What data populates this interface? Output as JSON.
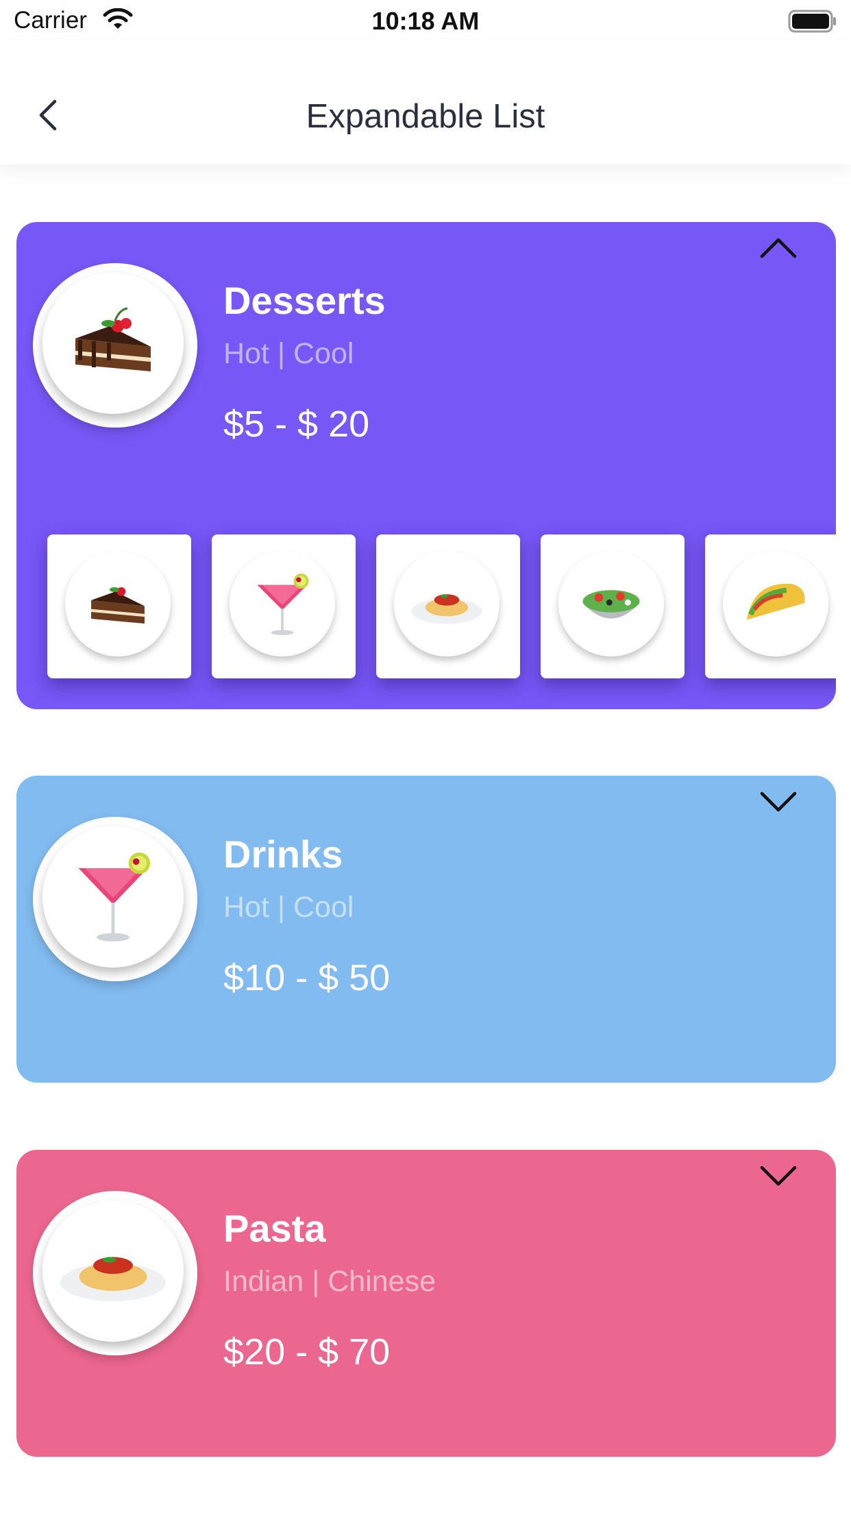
{
  "status_bar": {
    "carrier": "Carrier",
    "time": "10:18 AM"
  },
  "nav": {
    "title": "Expandable List",
    "back_icon": "chevron-left-icon"
  },
  "cards": [
    {
      "title": "Desserts",
      "subtitle": "Hot | Cool",
      "price": "$5 - $ 20",
      "color": "#7757f5",
      "expanded": true,
      "image": "cake-icon",
      "thumbnails": [
        "cake-icon",
        "cocktail-icon",
        "pasta-icon",
        "salad-icon",
        "taco-icon"
      ]
    },
    {
      "title": "Drinks",
      "subtitle": "Hot | Cool",
      "price": "$10 - $ 50",
      "color": "#82bbf0",
      "expanded": false,
      "image": "cocktail-icon"
    },
    {
      "title": "Pasta",
      "subtitle": "Indian | Chinese",
      "price": "$20 - $ 70",
      "color": "#ec678f",
      "expanded": false,
      "image": "pasta-icon"
    }
  ]
}
